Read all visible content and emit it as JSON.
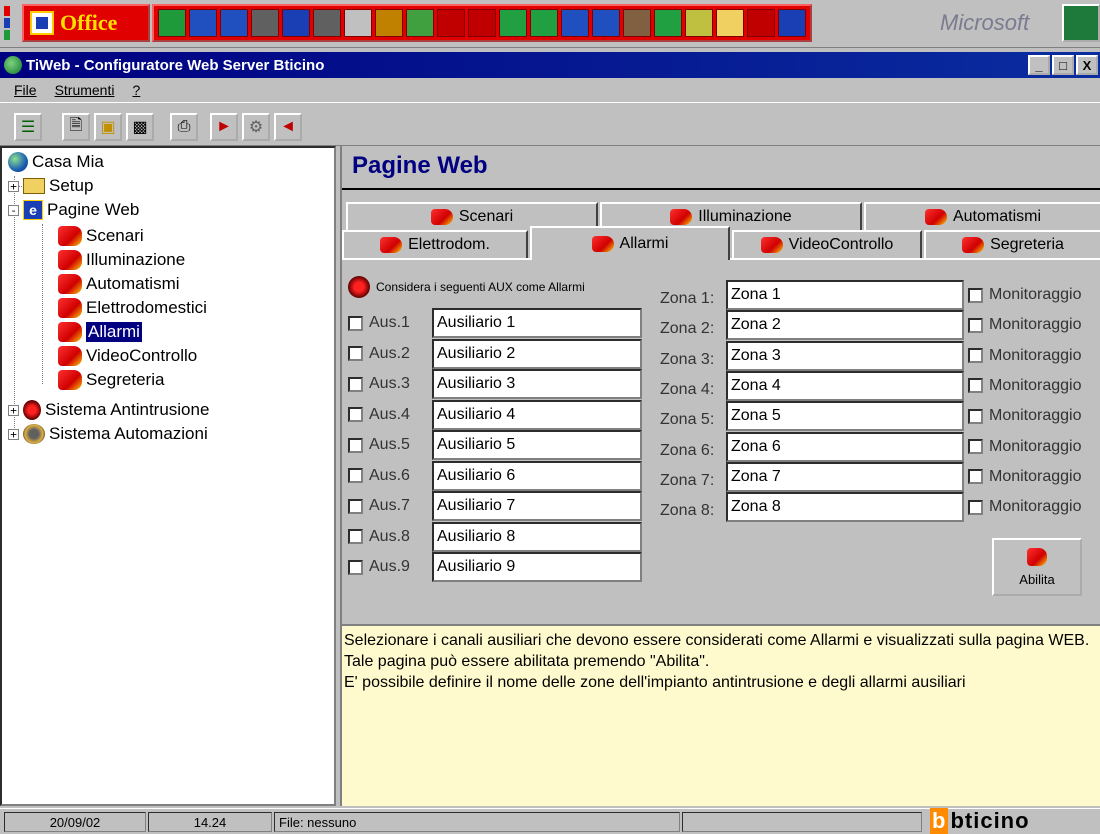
{
  "office_bar": {
    "office_label": "Office",
    "microsoft_label": "Microsoft",
    "app_icons": [
      "excel-icon",
      "monitor-icon",
      "word-icon",
      "palette-icon",
      "globe-icon",
      "database-icon",
      "modem-icon",
      "schedule-icon",
      "binder-icon",
      "acrobat-icon",
      "powerpoint-icon",
      "network-icon",
      "team-icon",
      "screen-icon",
      "calendar-icon",
      "calculator-icon",
      "dice-icon",
      "chart-icon",
      "folder-icon",
      "access-icon",
      "internet-icon"
    ]
  },
  "window": {
    "title": "TiWeb - Configuratore  Web Server Bticino",
    "controls": [
      "_",
      "□",
      "X"
    ]
  },
  "menu": [
    "File",
    "Strumenti",
    "?"
  ],
  "toolbar": [
    "tree-icon",
    "new-icon",
    "open-icon",
    "save-icon",
    "print-icon",
    "export-icon",
    "transfer-icon",
    "import-icon"
  ],
  "tree": {
    "root": "Casa Mia",
    "setup": "Setup",
    "pagine_web": "Pagine Web",
    "children": [
      "Scenari",
      "Illuminazione",
      "Automatismi",
      "Elettrodomestici",
      "Allarmi",
      "VideoControllo",
      "Segreteria"
    ],
    "antintrusione": "Sistema Antintrusione",
    "automazioni": "Sistema Automazioni",
    "selected": "Allarmi"
  },
  "panel": {
    "title": "Pagine Web",
    "tabs_row1": [
      "Scenari",
      "Illuminazione",
      "Automatismi"
    ],
    "tabs_row2": [
      "Elettrodom.",
      "Allarmi",
      "VideoControllo",
      "Segreteria"
    ],
    "active_tab": "Allarmi",
    "aux_header": "Considera i seguenti AUX come Allarmi",
    "aux": [
      {
        "label": "Aus.1",
        "value": "Ausiliario 1",
        "checked": false
      },
      {
        "label": "Aus.2",
        "value": "Ausiliario 2",
        "checked": false
      },
      {
        "label": "Aus.3",
        "value": "Ausiliario 3",
        "checked": false
      },
      {
        "label": "Aus.4",
        "value": "Ausiliario 4",
        "checked": false
      },
      {
        "label": "Aus.5",
        "value": "Ausiliario 5",
        "checked": false
      },
      {
        "label": "Aus.6",
        "value": "Ausiliario 6",
        "checked": false
      },
      {
        "label": "Aus.7",
        "value": "Ausiliario 7",
        "checked": false
      },
      {
        "label": "Aus.8",
        "value": "Ausiliario 8",
        "checked": false
      },
      {
        "label": "Aus.9",
        "value": "Ausiliario 9",
        "checked": false
      }
    ],
    "zones": [
      {
        "label": "Zona 1:",
        "value": "Zona 1",
        "monitor": "Monitoraggio"
      },
      {
        "label": "Zona 2:",
        "value": "Zona 2",
        "monitor": "Monitoraggio"
      },
      {
        "label": "Zona 3:",
        "value": "Zona 3",
        "monitor": "Monitoraggio"
      },
      {
        "label": "Zona 4:",
        "value": "Zona 4",
        "monitor": "Monitoraggio"
      },
      {
        "label": "Zona 5:",
        "value": "Zona 5",
        "monitor": "Monitoraggio"
      },
      {
        "label": "Zona 6:",
        "value": "Zona 6",
        "monitor": "Monitoraggio"
      },
      {
        "label": "Zona 7:",
        "value": "Zona 7",
        "monitor": "Monitoraggio"
      },
      {
        "label": "Zona 8:",
        "value": "Zona 8",
        "monitor": "Monitoraggio"
      }
    ],
    "abilita_label": "Abilita",
    "help_lines": [
      "Selezionare i canali ausiliari che devono essere considerati come Allarmi e visualizzati sulla pagina WEB.",
      "Tale pagina può essere abilitata premendo \"Abilita\".",
      "E' possibile definire il nome delle zone dell'impianto antintrusione e degli allarmi ausiliari"
    ]
  },
  "status": {
    "date": "20/09/02",
    "time": "14.24",
    "file": "File: nessuno",
    "brand": "bticino"
  },
  "colors": {
    "title_bar": "#000080",
    "office_red": "#e00000",
    "help_bg": "#fffacd",
    "selection": "#000080"
  }
}
